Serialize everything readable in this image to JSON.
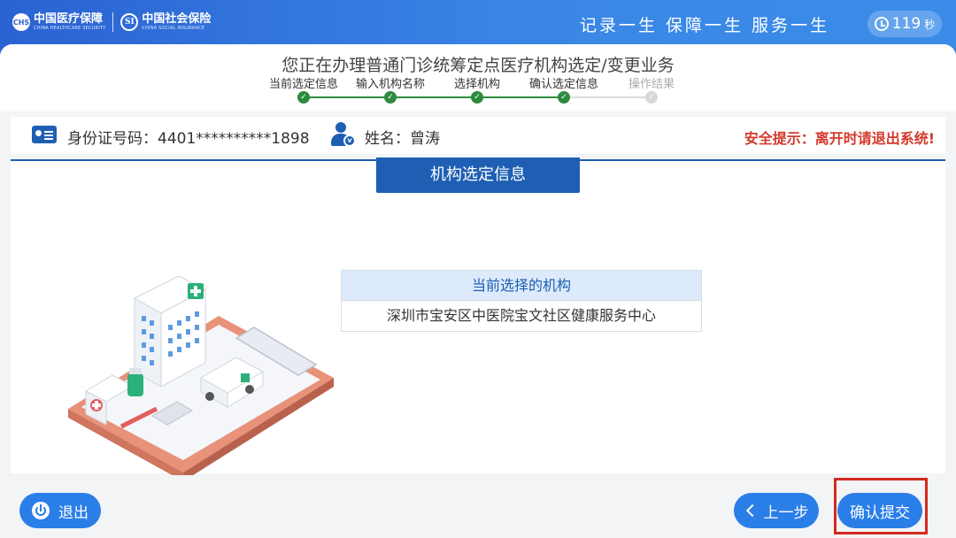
{
  "header": {
    "logo1_cn": "中国医疗保障",
    "logo1_en": "CHINA HEALTHCARE SECURITY",
    "logo1_badge": "CHS",
    "logo2_cn": "中国社会保险",
    "logo2_en": "CHINA SOCIAL INSURANCE",
    "logo2_badge": "SI",
    "slogan": "记录一生 保障一生 服务一生",
    "timer_value": "119",
    "timer_unit": "秒"
  },
  "page_title": "您正在办理普通门诊统筹定点医疗机构选定/变更业务",
  "steps": [
    {
      "label": "当前选定信息",
      "done": true
    },
    {
      "label": "输入机构名称",
      "done": true
    },
    {
      "label": "选择机构",
      "done": true
    },
    {
      "label": "确认选定信息",
      "done": true
    },
    {
      "label": "操作结果",
      "done": false
    }
  ],
  "info": {
    "id_text": "身份证号码：4401**********1898",
    "name_text": "姓名：曾涛",
    "warning": "安全提示：离开时请退出系统!"
  },
  "section_title": "机构选定信息",
  "institution": {
    "header": "当前选择的机构",
    "value": "深圳市宝安区中医院宝文社区健康服务中心"
  },
  "buttons": {
    "exit": "退出",
    "prev": "上一步",
    "confirm": "确认提交"
  },
  "colors": {
    "primary": "#1e5fb3",
    "button": "#2a7ee8",
    "step_done": "#2e8b3e",
    "warning": "#d33a2c",
    "highlight_box": "#d32a1e"
  }
}
